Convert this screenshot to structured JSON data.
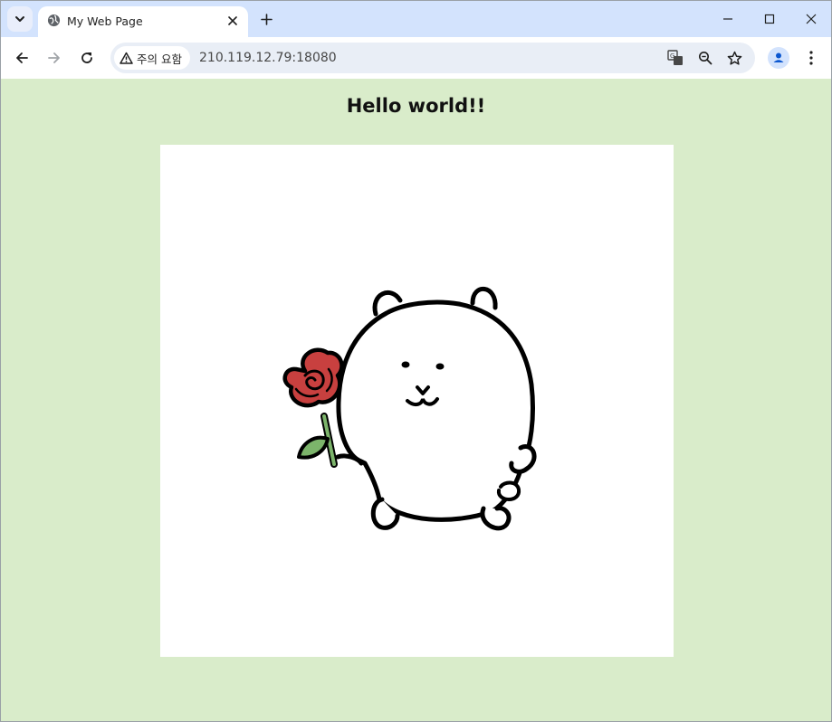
{
  "browser": {
    "tab": {
      "title": "My Web Page",
      "favicon": "globe-icon"
    },
    "address_bar": {
      "security_chip_label": "주의 요함",
      "url": "210.119.12.79:18080"
    },
    "icons": {
      "back": "back-arrow-icon",
      "forward": "forward-arrow-icon",
      "reload": "reload-icon",
      "translate": "translate-icon",
      "zoom": "zoom-out-icon",
      "bookmark": "star-icon",
      "profile": "profile-icon",
      "menu": "kebab-menu-icon",
      "minimize": "minimize-icon",
      "maximize": "maximize-icon",
      "close": "close-icon",
      "new_tab": "plus-icon",
      "tab_search": "chevron-down-icon",
      "warning": "warning-triangle-icon"
    }
  },
  "page": {
    "heading": "Hello world!!",
    "image": {
      "subject": "bear-holding-rose-illustration"
    },
    "background_color": "#d9ecca"
  },
  "colors": {
    "tabstrip": "#d3e3fd",
    "omnibox": "#e9eef6",
    "rose": "#c8403f",
    "stem": "#7cb46b"
  }
}
